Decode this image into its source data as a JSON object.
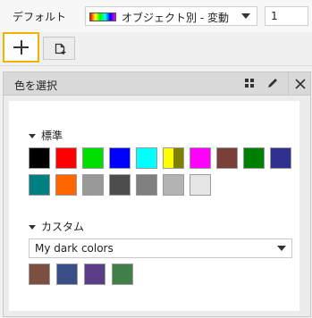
{
  "top": {
    "label": "デフォルト",
    "dropdown_text": "オブジェクト別 - 変動",
    "number_value": "1"
  },
  "panel": {
    "title": "色を選択",
    "standard": {
      "title": "標準",
      "colors": [
        "#000000",
        "#ff0000",
        "#00e000",
        "#0000ff",
        "#00ffff",
        "#ffff00|#808000",
        "#ff00ff",
        "#7b3f3a",
        "#008000",
        "#303090",
        "#008080",
        "#ff6600",
        "#999999",
        "#4d4d4d",
        "#808080",
        "#b3b3b3",
        "#e6e6e6"
      ]
    },
    "custom": {
      "title": "カスタム",
      "select_value": "My dark colors",
      "colors": [
        "#7b5040",
        "#3a4f86",
        "#5a3d84",
        "#3f8048"
      ]
    }
  }
}
